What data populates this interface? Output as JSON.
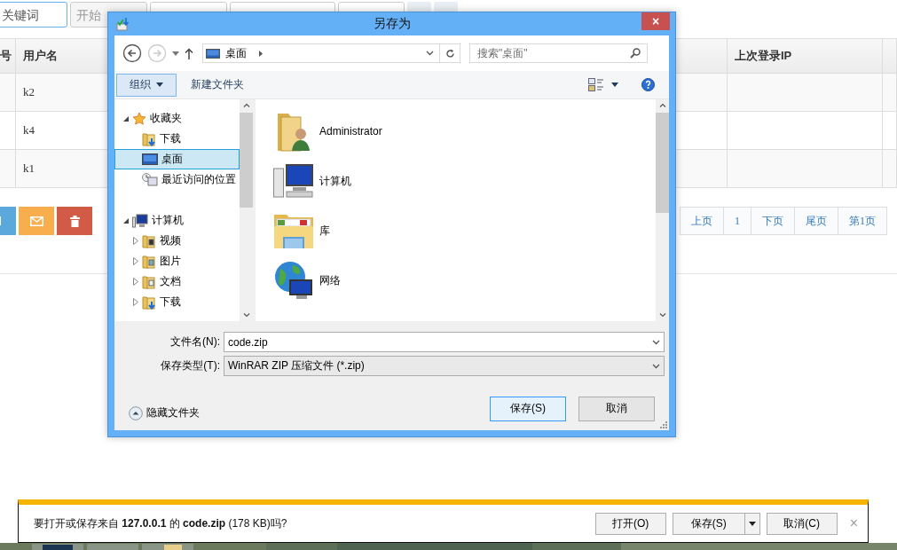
{
  "filter_bar": {
    "keyword": {
      "placeholder": "关键词"
    },
    "start_date": {
      "placeholder": "开始"
    }
  },
  "table": {
    "columns": [
      "号",
      "用户名",
      "上次登录IP"
    ],
    "rows": [
      {
        "username": "k2"
      },
      {
        "username": "k4"
      },
      {
        "username": "k1"
      }
    ]
  },
  "actions": [
    {
      "kind": "edit"
    },
    {
      "kind": "mail"
    },
    {
      "kind": "delete"
    }
  ],
  "pagination": [
    {
      "label": "上页"
    },
    {
      "label": "1"
    },
    {
      "label": "下页"
    },
    {
      "label": "尾页"
    },
    {
      "label": "第1页"
    }
  ],
  "dialog": {
    "title": "另存为",
    "close": "×",
    "address": "桌面",
    "search": {
      "placeholder": "搜索\"桌面\""
    },
    "toolbar": {
      "organize": "组织",
      "new_folder": "新建文件夹"
    },
    "nav_tree": [
      {
        "label": "收藏夹",
        "kind": "favorites",
        "expanded": true,
        "selected": false,
        "children": [
          {
            "label": "下载",
            "kind": "downloads",
            "selected": false
          },
          {
            "label": "桌面",
            "kind": "desktop",
            "selected": true
          },
          {
            "label": "最近访问的位置",
            "kind": "recent",
            "selected": false
          }
        ]
      },
      {
        "label": "计算机",
        "kind": "computer",
        "expanded": true,
        "selected": false,
        "children": [
          {
            "label": "视频",
            "kind": "videos",
            "expanded": false,
            "selected": false
          },
          {
            "label": "图片",
            "kind": "pictures",
            "expanded": false,
            "selected": false
          },
          {
            "label": "文档",
            "kind": "documents",
            "expanded": false,
            "selected": false
          },
          {
            "label": "下载",
            "kind": "downloads",
            "expanded": false,
            "selected": false
          }
        ]
      }
    ],
    "items": [
      {
        "name": "Administrator",
        "kind": "user"
      },
      {
        "name": "计算机",
        "kind": "computer"
      },
      {
        "name": "库",
        "kind": "library"
      },
      {
        "name": "网络",
        "kind": "network"
      }
    ],
    "file_name": {
      "label": "文件名(N):",
      "value": "code.zip"
    },
    "file_type": {
      "label": "保存类型(T):",
      "value": "WinRAR ZIP 压缩文件 (*.zip)"
    },
    "hide_folders": "隐藏文件夹",
    "buttons": [
      {
        "label": "保存(S)",
        "default": true
      },
      {
        "label": "取消",
        "default": false
      }
    ]
  },
  "download_bar": {
    "message": "要打开或保存来自 **127.0.0.1** 的 **code.zip** (178 KB)吗?",
    "buttons": [
      {
        "label": "打开(O)",
        "kind": "plain"
      },
      {
        "label": "保存(S)",
        "kind": "split"
      },
      {
        "label": "取消(C)",
        "kind": "plain"
      }
    ],
    "close": "×"
  }
}
